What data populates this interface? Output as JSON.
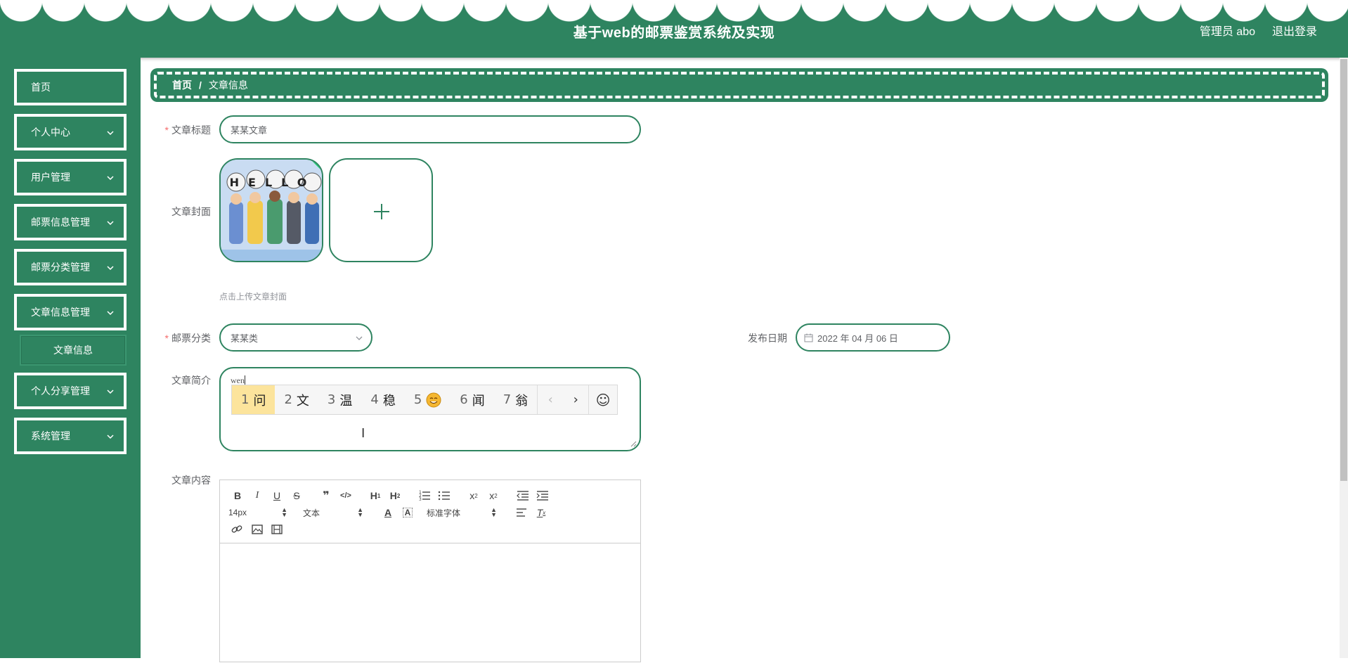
{
  "header": {
    "title": "基于web的邮票鉴赏系统及实现",
    "admin": "管理员 abo",
    "logout": "退出登录"
  },
  "sidebar": {
    "items": [
      {
        "label": "首页"
      },
      {
        "label": "个人中心"
      },
      {
        "label": "用户管理"
      },
      {
        "label": "邮票信息管理"
      },
      {
        "label": "邮票分类管理"
      },
      {
        "label": "文章信息管理"
      },
      {
        "label": "文章信息"
      },
      {
        "label": "个人分享管理"
      },
      {
        "label": "系统管理"
      }
    ]
  },
  "breadcrumb": {
    "home": "首页",
    "separator": "/",
    "current": "文章信息"
  },
  "form": {
    "title_label": "文章标题",
    "title_value": "某某文章",
    "cover_label": "文章封面",
    "cover_image_text": "HELLO",
    "cover_tip": "点击上传文章封面",
    "category_label": "邮票分类",
    "category_value": "某某类",
    "date_label": "发布日期",
    "date_value": "2022 年 04 月 06 日",
    "summary_label": "文章简介",
    "summary_value": "wen",
    "content_label": "文章内容",
    "required_mark": "*"
  },
  "ime": {
    "candidates": [
      {
        "num": "1",
        "text": "问"
      },
      {
        "num": "2",
        "text": "文"
      },
      {
        "num": "3",
        "text": "温"
      },
      {
        "num": "4",
        "text": "稳"
      },
      {
        "num": "5",
        "text": ""
      },
      {
        "num": "6",
        "text": "闻"
      },
      {
        "num": "7",
        "text": "翁"
      }
    ],
    "prev": "‹",
    "next": "›",
    "emoji": "☺"
  },
  "editor": {
    "font_size": "14px",
    "block_type": "文本",
    "font_family": "标准字体"
  },
  "colors": {
    "primary": "#2e8460",
    "required": "#f56c6c"
  }
}
